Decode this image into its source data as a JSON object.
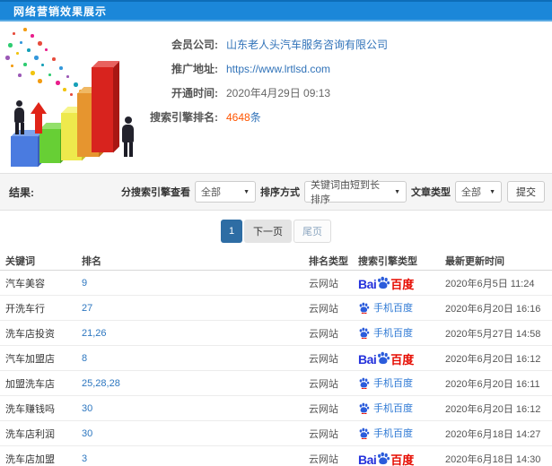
{
  "header": {
    "title": "网络营销效果展示"
  },
  "info": {
    "rows": [
      {
        "label": "会员公司:",
        "value": "山东老人头汽车服务咨询有限公司"
      },
      {
        "label": "推广地址:",
        "value": "https://www.lrtlsd.com"
      },
      {
        "label": "开通时间:",
        "value": "2020年4月29日 09:13"
      },
      {
        "label": "搜索引擎排名:",
        "count": "4648",
        "unit": "条"
      }
    ]
  },
  "filters": {
    "result_label": "结果:",
    "engine_filter_label": "分搜索引擎查看",
    "engine_filter_value": "全部",
    "sort_label": "排序方式",
    "sort_value": "关键词由短到长排序",
    "article_type_label": "文章类型",
    "article_type_value": "全部",
    "submit_label": "提交"
  },
  "pagination": {
    "current": "1",
    "next_label": "下一页",
    "last_label": "尾页"
  },
  "table": {
    "headers": [
      "关键词",
      "排名",
      "排名类型",
      "搜索引擎类型",
      "最新更新时间"
    ],
    "rows": [
      {
        "keyword": "汽车美容",
        "rank": "9",
        "rank_type": "云网站",
        "engine": "百度",
        "engine_icon": "baidu-logo",
        "updated": "2020年6月5日 11:24"
      },
      {
        "keyword": "开洗车行",
        "rank": "27",
        "rank_type": "云网站",
        "engine": "手机百度",
        "engine_icon": "baidu-mobile-logo",
        "updated": "2020年6月20日 16:16"
      },
      {
        "keyword": "洗车店投资",
        "rank": "21,26",
        "rank_type": "云网站",
        "engine": "手机百度",
        "engine_icon": "baidu-mobile-logo",
        "updated": "2020年5月27日 14:58"
      },
      {
        "keyword": "汽车加盟店",
        "rank": "8",
        "rank_type": "云网站",
        "engine": "百度",
        "engine_icon": "baidu-logo",
        "updated": "2020年6月20日 16:12"
      },
      {
        "keyword": "加盟洗车店",
        "rank": "25,28,28",
        "rank_type": "云网站",
        "engine": "手机百度",
        "engine_icon": "baidu-mobile-logo",
        "updated": "2020年6月20日 16:11"
      },
      {
        "keyword": "洗车赚钱吗",
        "rank": "30",
        "rank_type": "云网站",
        "engine": "手机百度",
        "engine_icon": "baidu-mobile-logo",
        "updated": "2020年6月20日 16:12"
      },
      {
        "keyword": "洗车店利润",
        "rank": "30",
        "rank_type": "云网站",
        "engine": "手机百度",
        "engine_icon": "baidu-mobile-logo",
        "updated": "2020年6月18日 14:27"
      },
      {
        "keyword": "洗车店加盟",
        "rank": "3",
        "rank_type": "云网站",
        "engine": "百度",
        "engine_icon": "baidu-logo",
        "updated": "2020年6月18日 14:30"
      }
    ]
  },
  "brand": {
    "baidu_latin": "Bai",
    "baidu_cn": "百度"
  },
  "colors": {
    "header_blue": "#1b87d9",
    "link_blue": "#3173b9",
    "rank_blue": "#2d77c0",
    "rank_count_orange": "#ff5500",
    "pagination_active_blue": "#2e6da4",
    "baidu_blue": "#2532dc",
    "baidu_red": "#e60b00",
    "mobile_baidu_blue": "#2d78d4"
  }
}
